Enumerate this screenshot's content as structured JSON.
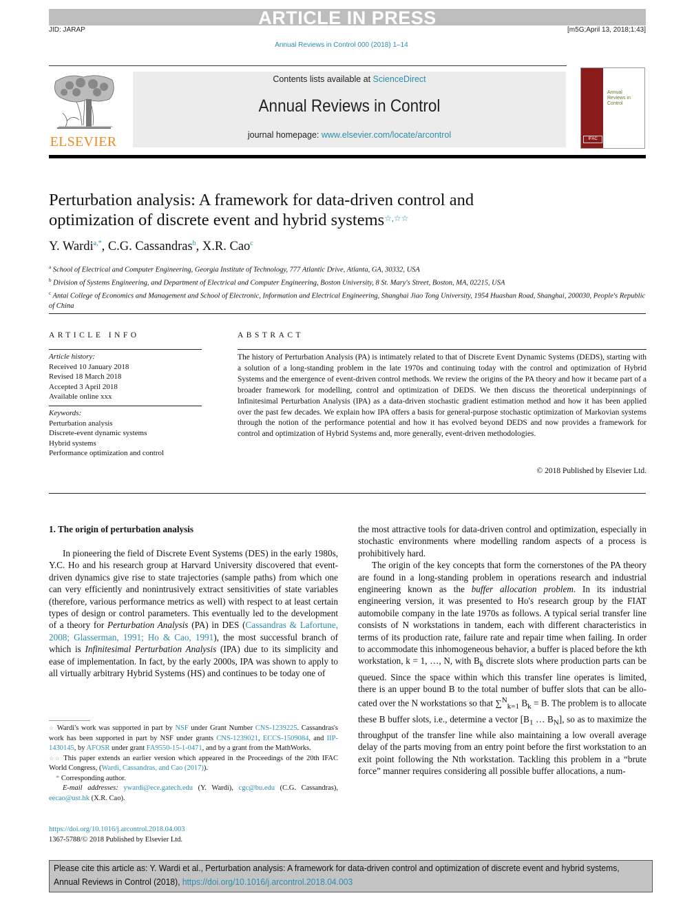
{
  "header": {
    "banner": "ARTICLE IN PRESS",
    "jid": "JID: JARAP",
    "stamp": "[m5G;April 13, 2018;1:43]",
    "journal_ref": "Annual Reviews in Control 000 (2018) 1–14"
  },
  "masthead": {
    "publisher_logo_text": "ELSEVIER",
    "contents_prefix": "Contents lists available at ",
    "contents_link": "ScienceDirect",
    "journal_title": "Annual Reviews in Control",
    "homepage_prefix": "journal homepage: ",
    "homepage_link": "www.elsevier.com/locate/arcontrol",
    "cover_title_lines": [
      "Annual",
      "Reviews in",
      "Control"
    ],
    "cover_badge": "IFAC",
    "brand_colors": {
      "link": "#2a8dae",
      "elsevier_orange": "#f08a1c",
      "cover_red": "#8b1a1a"
    }
  },
  "article": {
    "title_line1": "Perturbation analysis: A framework for data-driven control and",
    "title_line2": "optimization of discrete event and hybrid systems",
    "title_marks": "☆,☆☆",
    "authors": [
      {
        "name": "Y. Wardi",
        "sup": "a,*"
      },
      {
        "name": "C.G. Cassandras",
        "sup": "b"
      },
      {
        "name": "X.R. Cao",
        "sup": "c"
      }
    ],
    "affiliations": [
      {
        "sup": "a",
        "text": "School of Electrical and Computer Engineering, Georgia Institute of Technology, 777 Atlantic Drive, Atlanta, GA, 30332, USA"
      },
      {
        "sup": "b",
        "text": "Division of Systems Engineering, and Department of Electrical and Computer Engineering, Boston University, 8 St. Mary's Street, Boston, MA, 02215, USA"
      },
      {
        "sup": "c",
        "text": "Antai College of Economics and Management and School of Electronic, Information and Electrical Engineering, Shanghai Jiao Tong University, 1954 Huashan Road, Shanghai, 200030, People's Republic of China"
      }
    ]
  },
  "article_info": {
    "heading": "ARTICLE INFO",
    "history_label": "Article history:",
    "history": [
      "Received 10 January 2018",
      "Revised 18 March 2018",
      "Accepted 3 April 2018",
      "Available online xxx"
    ],
    "keywords_label": "Keywords:",
    "keywords": [
      "Perturbation analysis",
      "Discrete-event dynamic systems",
      "Hybrid systems",
      "Performance optimization and control"
    ]
  },
  "abstract": {
    "heading": "ABSTRACT",
    "text": "The history of Perturbation Analysis (PA) is intimately related to that of Discrete Event Dynamic Systems (DEDS), starting with a solution of a long-standing problem in the late 1970s and continuing today with the control and optimization of Hybrid Systems and the emergence of event-driven control methods. We review the origins of the PA theory and how it became part of a broader framework for modelling, control and optimization of DEDS. We then discuss the theoretical underpinnings of Infinitesimal Pertur­bation Analysis (IPA) as a data-driven stochastic gradient estimation method and how it has been applied over the past few decades. We explain how IPA offers a basis for general-purpose stochastic optimization of Markovian systems through the notion of the performance potential and how it has evolved beyond DEDS and now provides a framework for control and optimization of Hybrid Systems and, more generally, event-driven methodologies.",
    "copyright": "© 2018 Published by Elsevier Ltd."
  },
  "section1": {
    "heading": "1. The origin of perturbation analysis",
    "left_p1_a": "In pioneering the field of Discrete Event Systems (DES) in the early 1980s, Y.C. Ho and his research group at Harvard Univer­sity discovered that event-driven dynamics give rise to state tra­jectories (sample paths) from which one can very efficiently and nonintrusively extract sensitivities of state variables (therefore, var­ious performance metrics as well) with respect to at least cer­tain types of design or control parameters. This eventually led to the development of a theory for ",
    "left_p1_em1": "Perturbation Analysis",
    "left_p1_b": " (PA) in DES (",
    "left_p1_cite": "Cassandras & Lafortune, 2008; Glasserman, 1991; Ho & Cao, 1991",
    "left_p1_c": "), the most successful branch of which is ",
    "left_p1_em2": "Infinitesimal Perturbation Analysis",
    "left_p1_d": " (IPA) due to its simplicity and ease of implementation. In fact, by the early 2000s, IPA was shown to apply to all virtually arbitrary Hybrid Systems (HS) and continues to be today one of",
    "right_p1": "the most attractive tools for data-driven control and optimization, especially in stochastic environments where modelling random as­pects of a process is prohibitively hard.",
    "right_p2_a": "The origin of the key concepts that form the cornerstones of the PA theory are found in a long-standing problem in operations research and industrial engineering known as the ",
    "right_p2_em": "buffer allocation problem",
    "right_p2_b": ". In its industrial engineering version, it was presented to Ho's research group by the FIAT automobile company in the late 1970s as follows. A typical serial transfer line consists of N work­stations in tandem, each with different characteristics in terms of its production rate, failure rate and repair time when failing. In order to accommodate this inhomogeneous behavior, a buffer is placed before the kth workstation, k = 1, …, N, with B",
    "right_p2_c": " dis­crete slots where production parts can be queued. Since the space within which this transfer line operates is limited, there is an up­per bound B to the total number of buffer slots that can be allo­cated over the N workstations so that ∑",
    "right_p2_d": " B",
    "right_p2_e": " = B. The problem is to allocate these B buffer slots, i.e., determine a vector [B",
    "right_p2_f": " … B",
    "right_p2_g": "], so as to maximize the throughput of the transfer line while also maintaining a low overall average delay of the parts moving from an entry point before the first workstation to an exit point follow­ing the Nth workstation. Tackling this problem in a “brute force” manner requires considering all possible buffer allocations, a num-"
  },
  "footnotes": {
    "f1_a": "Wardi's work was supported in part by ",
    "f1_nsf": "NSF",
    "f1_b": " under Grant Number ",
    "f1_g1": "CNS-1239225",
    "f1_c": ". Cassandras's work has been supported in part by NSF under grants ",
    "f1_g2": "CNS-1239021",
    "f1_sep1": ", ",
    "f1_g3": "ECCS-1509084",
    "f1_d": ", and ",
    "f1_g4": "IIP-1430145",
    "f1_e": ", by ",
    "f1_afosr": "AFOSR",
    "f1_f": " under grant ",
    "f1_g5": "FA9550-15-1-0471",
    "f1_g": ", and by a grant from the MathWorks.",
    "f2_a": "This paper extends an earlier version which appeared in the Proceedings of the 20th IFAC World Congress, (",
    "f2_cite": "Wardi, Cassandras, and Cao (2017)",
    "f2_b": ").",
    "corresponding": "Corresponding author.",
    "email_label": "E-mail addresses:",
    "email1": "ywardi@ece.gatech.edu",
    "email1_who": " (Y. Wardi), ",
    "email2": "cgc@bu.edu",
    "email2_who": " (C.G. Cassan­dras), ",
    "email3": "eecao@ust.hk",
    "email3_who": " (X.R. Cao).",
    "doi": "https://doi.org/10.1016/j.arcontrol.2018.04.003",
    "issn": "1367-5788/© 2018 Published by Elsevier Ltd."
  },
  "citation_box": {
    "text": "Please cite this article as: Y. Wardi et al., Perturbation analysis: A framework for data-driven control and optimization of discrete event and hybrid systems, Annual Reviews in Control (2018), ",
    "link": "https://doi.org/10.1016/j.arcontrol.2018.04.003"
  }
}
